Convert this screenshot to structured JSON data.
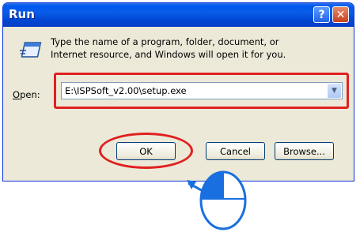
{
  "window": {
    "title": "Run",
    "help_label": "?",
    "close_label": "✕"
  },
  "dialog": {
    "message_line1": "Type the name of a program, folder, document, or",
    "message_line2": "Internet resource, and Windows will open it for you."
  },
  "open": {
    "label_prefix": "",
    "label_mnemonic": "O",
    "label_rest": "pen:",
    "value": "E:\\ISPSoft_v2.00\\setup.exe"
  },
  "buttons": {
    "ok": "OK",
    "cancel": "Cancel",
    "browse": "Browse..."
  },
  "colors": {
    "highlight": "#e02020",
    "pointer": "#1a6fe0",
    "titlebar": "#0058ee"
  },
  "annotation": {
    "pointer_icon": "mouse-left-click-icon",
    "arrow_icon": "arrow-up-left-icon"
  }
}
